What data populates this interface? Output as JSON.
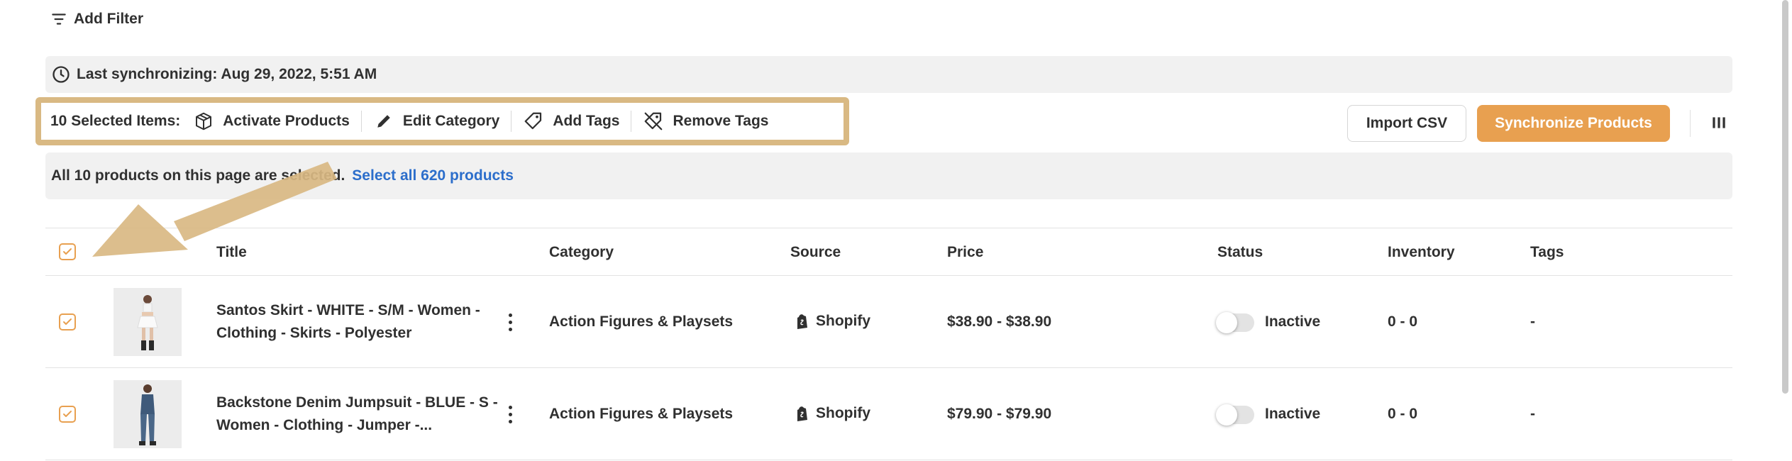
{
  "filter": {
    "add_label": "Add Filter"
  },
  "sync": {
    "label": "Last synchronizing: Aug 29, 2022, 5:51 AM"
  },
  "bulk": {
    "count_label": "10 Selected Items:",
    "actions": [
      {
        "label": "Activate Products",
        "icon": "box-icon"
      },
      {
        "label": "Edit Category",
        "icon": "pencil-icon"
      },
      {
        "label": "Add Tags",
        "icon": "tag-icon"
      },
      {
        "label": "Remove Tags",
        "icon": "tag-off-icon"
      }
    ]
  },
  "toolbar": {
    "import_label": "Import CSV",
    "sync_label": "Synchronize Products",
    "accent_color": "#e8a050"
  },
  "notice": {
    "text": "All 10 products on this page are selected.",
    "link": "Select all 620 products"
  },
  "table": {
    "headers": {
      "title": "Title",
      "category": "Category",
      "source": "Source",
      "price": "Price",
      "status": "Status",
      "inventory": "Inventory",
      "tags": "Tags"
    },
    "rows": [
      {
        "title": "Santos Skirt - WHITE - S/M - Women - Clothing - Skirts - Polyester",
        "category": "Action Figures & Playsets",
        "source": "Shopify",
        "price": "$38.90 - $38.90",
        "status": "Inactive",
        "inventory": "0 - 0",
        "tags": "-",
        "checked": true
      },
      {
        "title": "Backstone Denim Jumpsuit - BLUE - S - Women - Clothing - Jumper -...",
        "category": "Action Figures & Playsets",
        "source": "Shopify",
        "price": "$79.90 - $79.90",
        "status": "Inactive",
        "inventory": "0 - 0",
        "tags": "-",
        "checked": true
      }
    ]
  }
}
